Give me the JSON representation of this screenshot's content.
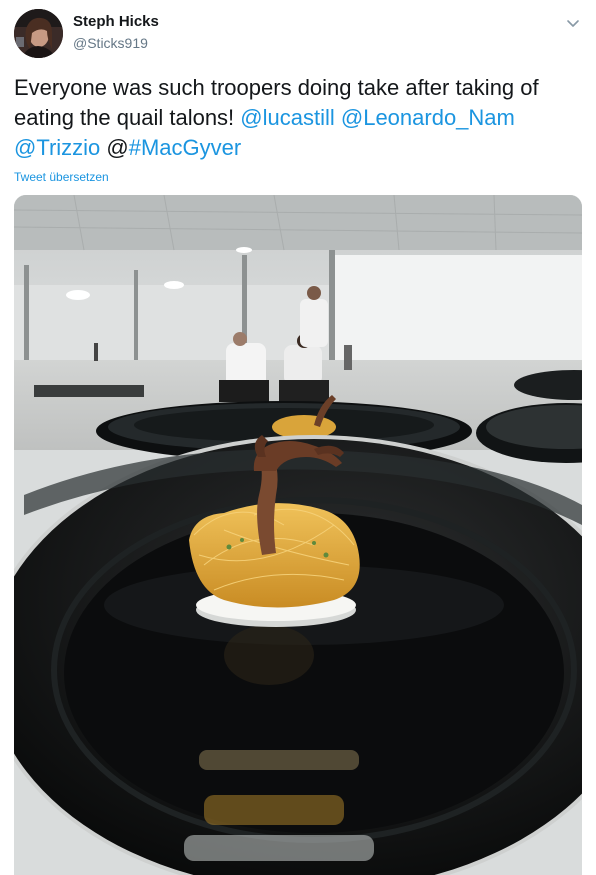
{
  "user": {
    "name": "Steph Hicks",
    "handle": "@Sticks919"
  },
  "tweet": {
    "text_before": "Everyone was such troopers doing take after taking of eating the quail talons! ",
    "mention_1": "@lucastill",
    "mention_2": "@Leonardo_Nam",
    "mention_3": "@Trizzio",
    "text_at": " @",
    "hashtag": "#MacGyver"
  },
  "translate_label": "Tweet übersetzen",
  "icons": {
    "caret": "chevron-down-icon"
  },
  "colors": {
    "link": "#1b95e0",
    "handle": "#657786",
    "text": "#14171a"
  }
}
